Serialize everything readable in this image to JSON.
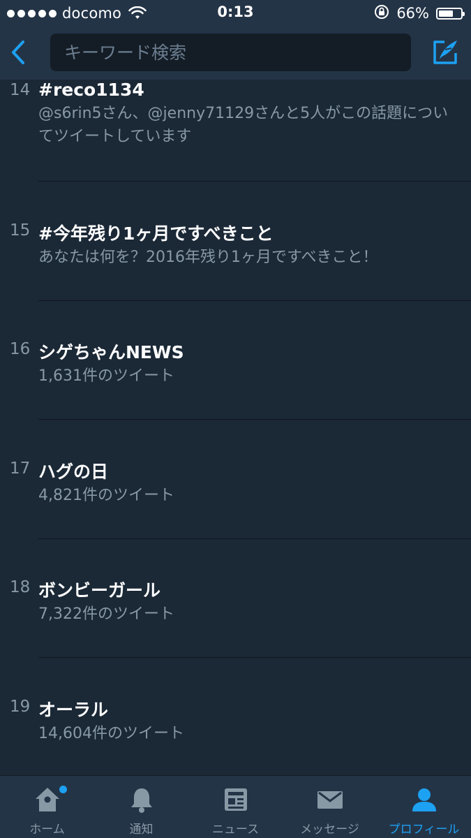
{
  "status_bar": {
    "carrier": "docomo",
    "time": "0:13",
    "battery_percent": "66%",
    "battery_level": 0.66
  },
  "nav": {
    "search_placeholder": "キーワード検索",
    "back_icon": "chevron-left-icon",
    "compose_icon": "compose-tweet-icon"
  },
  "trends": [
    {
      "rank": "14",
      "name": "#reco1134",
      "desc": "@s6rin5さん、@jenny71129さんと5人がこの話題についてツイートしています"
    },
    {
      "rank": "15",
      "name": "#今年残り1ヶ月ですべきこと",
      "desc": "あなたは何を？2016年残り1ヶ月ですべきこと！"
    },
    {
      "rank": "16",
      "name": "シゲちゃんNEWS",
      "desc": "1,631件のツイート"
    },
    {
      "rank": "17",
      "name": "ハグの日",
      "desc": "4,821件のツイート"
    },
    {
      "rank": "18",
      "name": "ボンビーガール",
      "desc": "7,322件のツイート"
    },
    {
      "rank": "19",
      "name": "オーラル",
      "desc": "14,604件のツイート"
    }
  ],
  "tabs": [
    {
      "label": "ホーム",
      "icon": "home-icon"
    },
    {
      "label": "通知",
      "icon": "bell-icon"
    },
    {
      "label": "ニュース",
      "icon": "news-icon"
    },
    {
      "label": "メッセージ",
      "icon": "envelope-icon"
    },
    {
      "label": "プロフィール",
      "icon": "person-icon"
    }
  ],
  "colors": {
    "background": "#1b2836",
    "bar": "#243447",
    "accent": "#1da1f2",
    "secondary_text": "#8899a6"
  }
}
